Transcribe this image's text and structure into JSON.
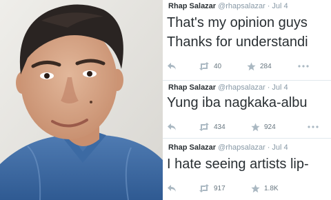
{
  "tweets": [
    {
      "name": "Rhap Salazar",
      "handle": "@rhapsalazar",
      "separator": "·",
      "date": "Jul 4",
      "lines": [
        "That's my opinion guys",
        "Thanks for understandi"
      ],
      "retweets": "40",
      "favorites": "284"
    },
    {
      "name": "Rhap Salazar",
      "handle": "@rhapsalazar",
      "separator": "·",
      "date": "Jul 4",
      "lines": [
        "Yung iba nagkaka-albu"
      ],
      "retweets": "434",
      "favorites": "924"
    },
    {
      "name": "Rhap Salazar",
      "handle": "@rhapsalazar",
      "separator": "·",
      "date": "Jul 4",
      "lines": [
        "I hate seeing artists lip-"
      ],
      "retweets": "917",
      "favorites": "1.8K"
    }
  ],
  "icons": {
    "reply": "reply-icon",
    "retweet": "retweet-icon",
    "favorite": "star-icon",
    "more": "more-icon"
  },
  "colors": {
    "text": "#292f33",
    "muted": "#8899a6",
    "icon": "#aab8c2",
    "divider": "#e1e8ed"
  }
}
